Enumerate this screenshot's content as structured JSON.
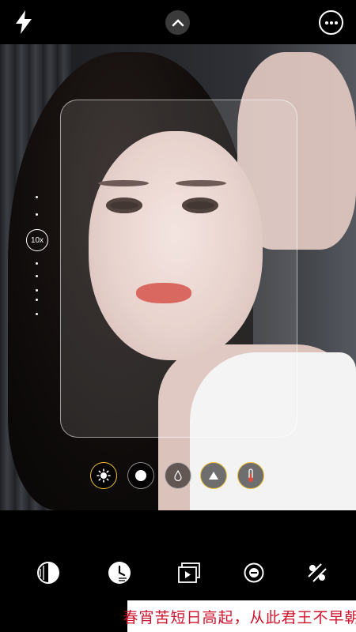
{
  "top_bar": {
    "flash_icon": "lightning-icon",
    "expand_icon": "chevron-up-icon",
    "more_icon": "ellipsis-icon"
  },
  "zoom": {
    "label": "10x"
  },
  "filters": [
    {
      "icon": "sun-icon",
      "highlighted": true
    },
    {
      "icon": "circle-filled-icon",
      "highlighted": false
    },
    {
      "icon": "drop-icon",
      "highlighted": false
    },
    {
      "icon": "triangle-icon",
      "highlighted": true
    },
    {
      "icon": "thermometer-icon",
      "highlighted": true
    }
  ],
  "bottom_tools": [
    {
      "icon": "aperture-icon"
    },
    {
      "icon": "timer-icon"
    },
    {
      "icon": "live-photo-icon"
    },
    {
      "icon": "minus-circle-icon"
    },
    {
      "icon": "no-filter-icon"
    }
  ],
  "caption": {
    "text": "春宵苦短日高起，从此君王不早朝"
  },
  "colors": {
    "accent_ring": "#f2c230",
    "caption_text": "#d0112b"
  }
}
